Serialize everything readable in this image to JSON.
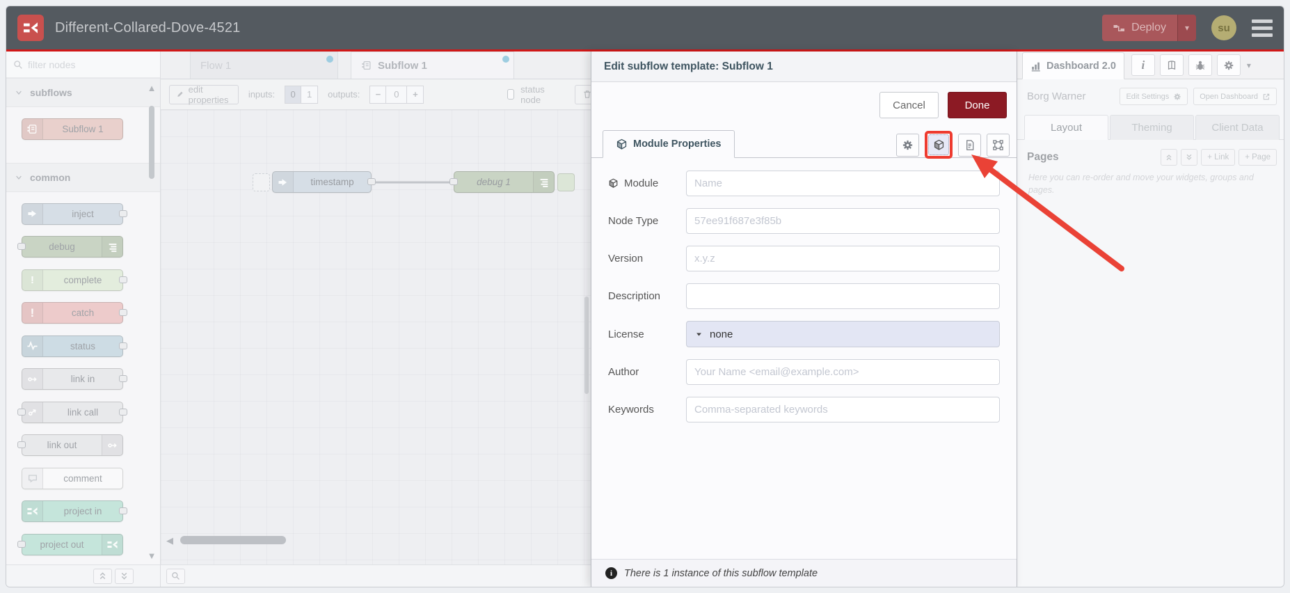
{
  "header": {
    "title": "Different-Collared-Dove-4521",
    "deploy_label": "Deploy",
    "avatar_initials": "su"
  },
  "palette": {
    "filter_placeholder": "filter nodes",
    "sections": [
      {
        "label": "subflows",
        "items": [
          {
            "label": "Subflow 1",
            "color": "#d9aea7"
          }
        ]
      },
      {
        "label": "common",
        "items": [
          {
            "label": "inject",
            "color": "#b9c7d4"
          },
          {
            "label": "debug",
            "color": "#a2b699"
          },
          {
            "label": "complete",
            "color": "#cfe1c5"
          },
          {
            "label": "catch",
            "color": "#e0a6a5"
          },
          {
            "label": "status",
            "color": "#aac3d0"
          },
          {
            "label": "link in",
            "color": "#d8d9dd"
          },
          {
            "label": "link call",
            "color": "#d8d9dd"
          },
          {
            "label": "link out",
            "color": "#d8d9dd"
          },
          {
            "label": "comment",
            "color": "#f4f5f7"
          },
          {
            "label": "project in",
            "color": "#9cd2c2"
          },
          {
            "label": "project out",
            "color": "#9cd2c2"
          }
        ]
      }
    ]
  },
  "workspace": {
    "tabs": [
      {
        "label": "Flow 1"
      },
      {
        "label": "Subflow 1"
      }
    ],
    "toolbar": {
      "edit_properties": "edit properties",
      "inputs_label": "inputs:",
      "inputs_options": [
        "0",
        "1"
      ],
      "outputs_label": "outputs:",
      "outputs_minus": "−",
      "outputs_value": "0",
      "outputs_plus": "+",
      "status_node_label": "status node"
    },
    "nodes": [
      {
        "label": "timestamp",
        "color": "#b9c7d4"
      },
      {
        "label": "debug 1",
        "color": "#a2b699"
      }
    ]
  },
  "dialog": {
    "title": "Edit subflow template: Subflow 1",
    "cancel_label": "Cancel",
    "done_label": "Done",
    "tab_label": "Module Properties",
    "fields": [
      {
        "label": "Module",
        "placeholder": "Name"
      },
      {
        "label": "Node Type",
        "placeholder": "57ee91f687e3f85b"
      },
      {
        "label": "Version",
        "placeholder": "x.y.z"
      },
      {
        "label": "Description",
        "placeholder": ""
      },
      {
        "label": "License",
        "value": "none"
      },
      {
        "label": "Author",
        "placeholder": "Your Name <email@example.com>"
      },
      {
        "label": "Keywords",
        "placeholder": "Comma-separated keywords"
      }
    ],
    "footer_text": "There is 1 instance of this subflow template"
  },
  "sidebar": {
    "tab_label": "Dashboard 2.0",
    "board_name": "Borg Warner",
    "edit_settings_label": "Edit Settings",
    "open_dashboard_label": "Open Dashboard",
    "tabs": [
      "Layout",
      "Theming",
      "Client Data"
    ],
    "pages_label": "Pages",
    "link_button": "+ Link",
    "page_button": "+ Page",
    "help_text": "Here you can re-order and move your widgets, groups and pages."
  },
  "colors": {
    "header_bg": "#545a60",
    "accent_red_line": "#d01818",
    "deploy_bg": "#a9575b",
    "done_button": "#8c1a24",
    "annotation_red": "#ea4236",
    "tab_dot": "#57a9cb",
    "license_field_bg": "#e3e6f4"
  }
}
